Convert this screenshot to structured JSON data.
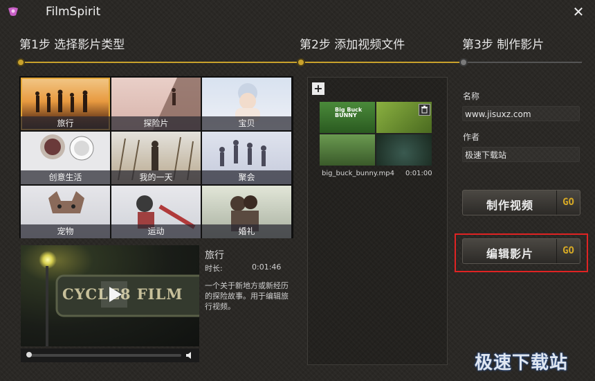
{
  "app": {
    "title": "FilmSpirit"
  },
  "steps": [
    "第1步 选择影片类型",
    "第2步 添加视频文件",
    "第3步 制作影片"
  ],
  "categories": [
    {
      "label": "旅行"
    },
    {
      "label": "探险片"
    },
    {
      "label": "宝贝"
    },
    {
      "label": "创意生活"
    },
    {
      "label": "我的一天"
    },
    {
      "label": "聚会"
    },
    {
      "label": "宠物"
    },
    {
      "label": "运动"
    },
    {
      "label": "婚礼"
    }
  ],
  "preview": {
    "film_text": "CYCLE8 FILM"
  },
  "info": {
    "name": "旅行",
    "duration_label": "时长:",
    "duration": "0:01:46",
    "description": "一个关于新地方或新经历的探险故事。用于编辑旅行视频。"
  },
  "media": {
    "thumb_text": "Big Buck BUNNY",
    "file_name": "big_buck_bunny.mp4",
    "file_duration": "0:01:00"
  },
  "form": {
    "name_label": "名称",
    "name_value": "www.jisuxz.com",
    "author_label": "作者",
    "author_value": "极速下载站"
  },
  "buttons": {
    "make": "制作视频",
    "edit": "编辑影片",
    "go": "GO"
  },
  "watermark": "极速下载站",
  "colors": {
    "accent": "#c9a22c",
    "highlight": "#e02323",
    "selected": "#e3a636"
  }
}
